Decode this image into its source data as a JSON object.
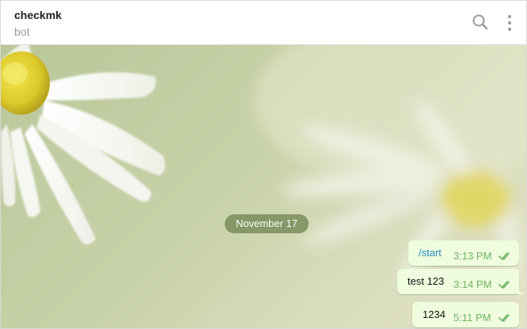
{
  "header": {
    "title": "checkmk",
    "subtitle": "bot",
    "search_icon": "search-icon",
    "more_icon": "more-vertical-icon"
  },
  "date_badge": "November 17",
  "messages": [
    {
      "text": "/start",
      "time": "3:13 PM",
      "status": "read",
      "is_command": true
    },
    {
      "text": "test 123",
      "time": "3:14 PM",
      "status": "read",
      "is_command": false
    },
    {
      "text": "1234",
      "time": "5:11 PM",
      "status": "read",
      "is_command": false
    }
  ],
  "colors": {
    "bubble": "#effdde",
    "time_text": "#6fb265",
    "command_link": "#2b88c5",
    "date_badge_bg": "#6e8250"
  }
}
